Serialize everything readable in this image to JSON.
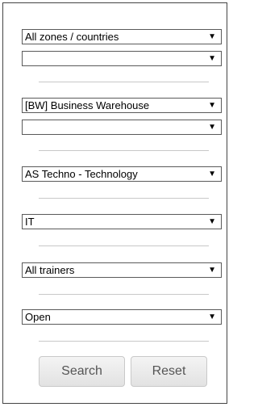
{
  "filters": [
    {
      "value": "All zones / countries",
      "arrow": "▼"
    },
    {
      "value": "",
      "arrow": "▼"
    },
    {
      "value": "[BW] Business Warehouse",
      "arrow": "▼"
    },
    {
      "value": "",
      "arrow": "▼"
    },
    {
      "value": "AS Techno - Technology",
      "arrow": "▼"
    },
    {
      "value": "IT",
      "arrow": "▼"
    },
    {
      "value": "All trainers",
      "arrow": "▼"
    },
    {
      "value": "Open",
      "arrow": "▼"
    }
  ],
  "buttons": {
    "search": "Search",
    "reset": "Reset"
  },
  "colors": {
    "border": "#444444",
    "divider": "#c8c8c8",
    "button_text": "#555555"
  }
}
